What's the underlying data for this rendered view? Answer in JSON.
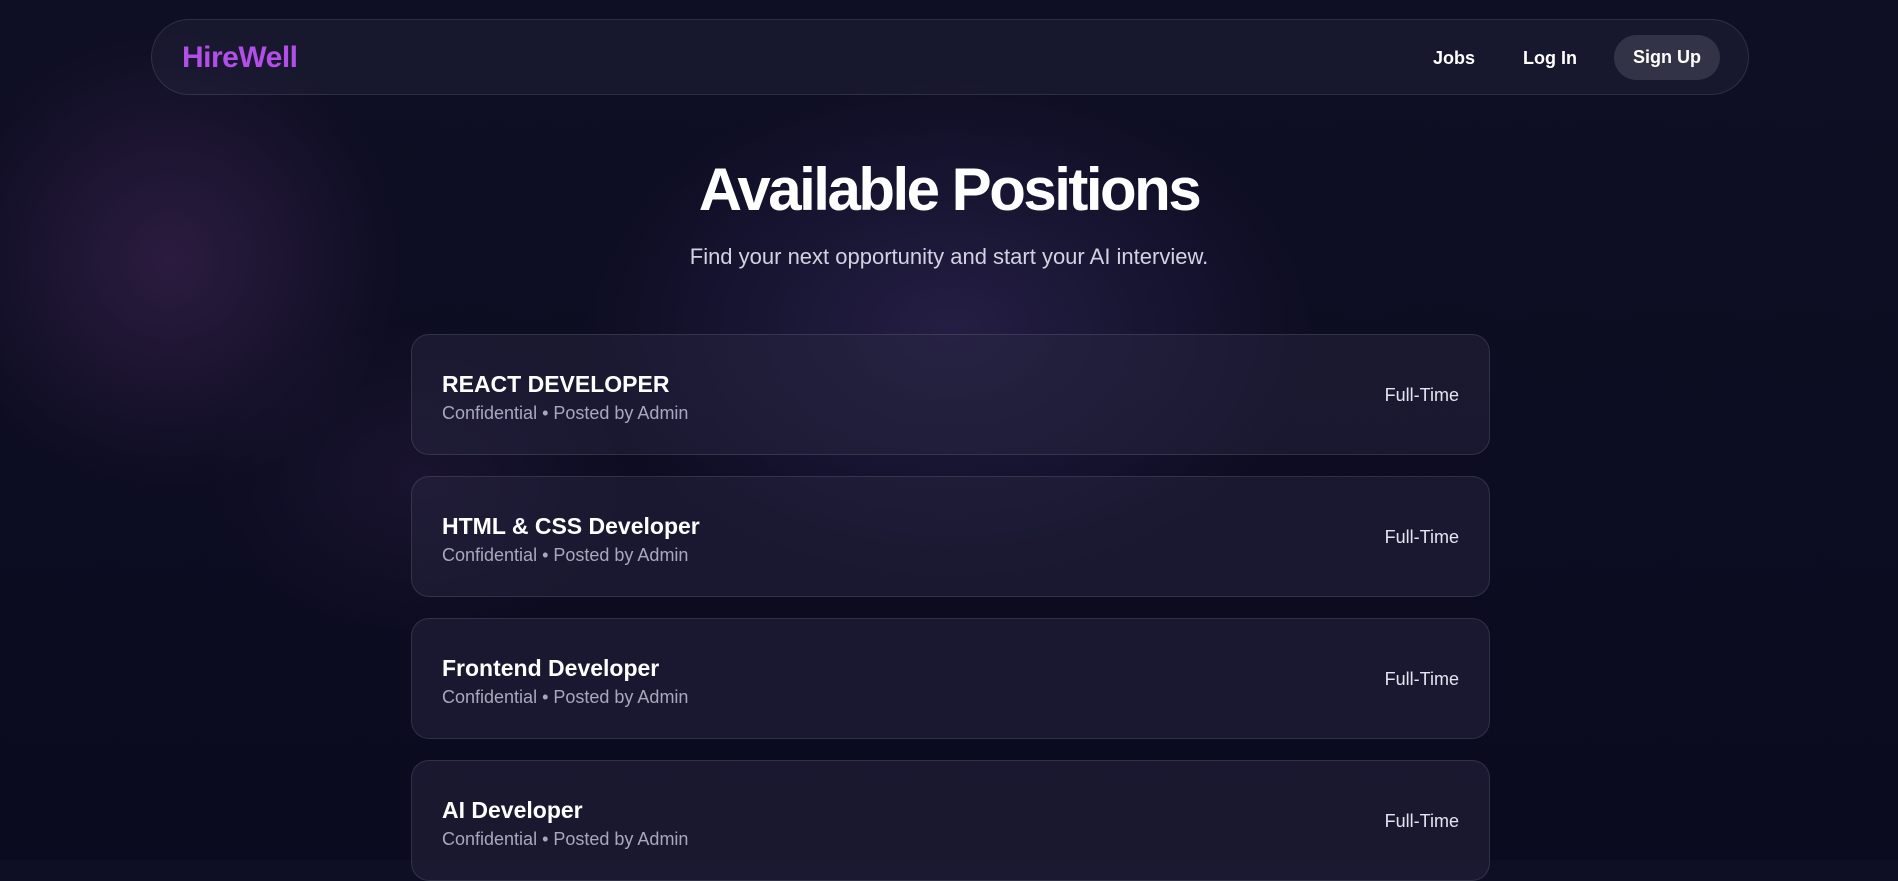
{
  "navbar": {
    "brand": "HireWell",
    "links": {
      "jobs": "Jobs",
      "login": "Log In"
    },
    "signup": "Sign Up"
  },
  "hero": {
    "title": "Available Positions",
    "subtitle": "Find your next opportunity and start your AI interview."
  },
  "colors": {
    "brand": "#b34ee8",
    "background": "#0c0c20"
  },
  "jobs": [
    {
      "title": "REACT DEVELOPER",
      "meta": "Confidential • Posted by Admin",
      "type": "Full-Time"
    },
    {
      "title": "HTML & CSS Developer",
      "meta": "Confidential • Posted by Admin",
      "type": "Full-Time"
    },
    {
      "title": "Frontend Developer",
      "meta": "Confidential • Posted by Admin",
      "type": "Full-Time"
    },
    {
      "title": "AI Developer",
      "meta": "Confidential • Posted by Admin",
      "type": "Full-Time"
    }
  ]
}
